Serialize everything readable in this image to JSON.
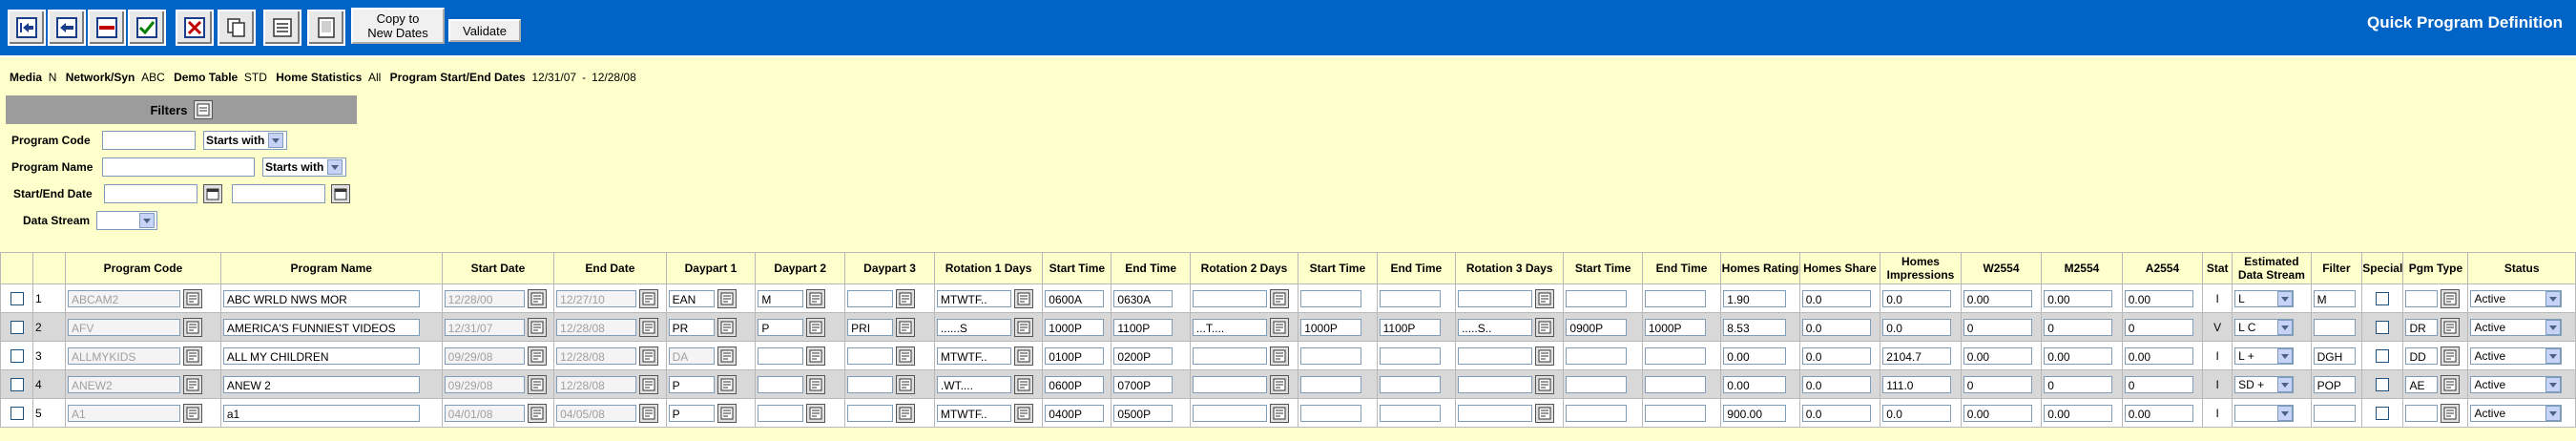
{
  "app": {
    "title": "Quick Program Definition"
  },
  "toolbar": {
    "copy_label_line1": "Copy to",
    "copy_label_line2": "New Dates",
    "validate_label": "Validate"
  },
  "info": {
    "media_label": "Media",
    "media_value": "N",
    "network_label": "Network/Syn",
    "network_value": "ABC",
    "demo_label": "Demo Table",
    "demo_value": "STD",
    "homestats_label": "Home Statistics",
    "homestats_value": "All",
    "dates_label": "Program Start/End Dates",
    "start": "12/31/07",
    "sep": "-",
    "end": "12/28/08"
  },
  "filters": {
    "title": "Filters",
    "program_code_label": "Program Code",
    "program_code_op": "Starts with",
    "program_name_label": "Program Name",
    "program_name_op": "Starts with",
    "date_label": "Start/End Date",
    "data_stream_label": "Data Stream"
  },
  "columns": [
    "Program Code",
    "Program Name",
    "Start Date",
    "End Date",
    "Daypart 1",
    "Daypart 2",
    "Daypart 3",
    "Rotation 1 Days",
    "Start Time",
    "End Time",
    "Rotation 2 Days",
    "Start Time",
    "End Time",
    "Rotation 3 Days",
    "Start Time",
    "End Time",
    "Homes Rating",
    "Homes Share",
    "Homes Impressions",
    "W2554",
    "M2554",
    "A2554",
    "Stat",
    "Estimated Data Stream",
    "Filter",
    "Special",
    "Pgm Type",
    "Status"
  ],
  "rows": [
    {
      "n": "1",
      "code": "ABCAM2",
      "name": "ABC WRLD NWS MOR",
      "start": "12/28/00",
      "end": "12/27/10",
      "dp1": "EAN",
      "dp2": "M",
      "dp3": "",
      "r1": "MTWTF..",
      "s1": "0600A",
      "e1": "0630A",
      "r2": "",
      "s2": "",
      "e2": "",
      "r3": "",
      "s3": "",
      "e3": "",
      "rating": "1.90",
      "share": "0.0",
      "imp": "0.0",
      "w": "0.00",
      "m": "0.00",
      "a": "0.00",
      "stat": "I",
      "eds": "L",
      "filter": "M",
      "pgm": "",
      "status": "Active"
    },
    {
      "n": "2",
      "code": "AFV",
      "name": "AMERICA'S FUNNIEST VIDEOS",
      "start": "12/31/07",
      "end": "12/28/08",
      "dp1": "PR",
      "dp2": "P",
      "dp3": "PRI",
      "r1": "......S",
      "s1": "1000P",
      "e1": "1100P",
      "r2": "...T....",
      "s2": "1000P",
      "e2": "1100P",
      "r3": ".....S..",
      "s3": "0900P",
      "e3": "1000P",
      "rating": "8.53",
      "share": "0.0",
      "imp": "0.0",
      "w": "0",
      "m": "0",
      "a": "0",
      "stat": "V",
      "eds": "L C",
      "filter": "",
      "pgm": "DR",
      "status": "Active"
    },
    {
      "n": "3",
      "code": "ALLMYKIDS",
      "name": "ALL MY CHILDREN",
      "start": "09/29/08",
      "end": "12/28/08",
      "dp1": "DA",
      "dp2": "",
      "dp3": "",
      "r1": "MTWTF..",
      "s1": "0100P",
      "e1": "0200P",
      "r2": "",
      "s2": "",
      "e2": "",
      "r3": "",
      "s3": "",
      "e3": "",
      "rating": "0.00",
      "share": "0.0",
      "imp": "2104.7",
      "w": "0.00",
      "m": "0.00",
      "a": "0.00",
      "stat": "I",
      "eds": "L +",
      "filter": "DGH",
      "pgm": "DD",
      "status": "Active"
    },
    {
      "n": "4",
      "code": "ANEW2",
      "name": "ANEW 2",
      "start": "09/29/08",
      "end": "12/28/08",
      "dp1": "P",
      "dp2": "",
      "dp3": "",
      "r1": ".WT....",
      "s1": "0600P",
      "e1": "0700P",
      "r2": "",
      "s2": "",
      "e2": "",
      "r3": "",
      "s3": "",
      "e3": "",
      "rating": "0.00",
      "share": "0.0",
      "imp": "111.0",
      "w": "0",
      "m": "0",
      "a": "0",
      "stat": "I",
      "eds": "SD +",
      "filter": "POP",
      "pgm": "AE",
      "status": "Active"
    },
    {
      "n": "5",
      "code": "A1",
      "name": "a1",
      "start": "04/01/08",
      "end": "04/05/08",
      "dp1": "P",
      "dp2": "",
      "dp3": "",
      "r1": "MTWTF..",
      "s1": "0400P",
      "e1": "0500P",
      "r2": "",
      "s2": "",
      "e2": "",
      "r3": "",
      "s3": "",
      "e3": "",
      "rating": "900.00",
      "share": "0.0",
      "imp": "0.0",
      "w": "0.00",
      "m": "0.00",
      "a": "0.00",
      "stat": "I",
      "eds": "",
      "filter": "",
      "pgm": "",
      "status": "Active"
    }
  ]
}
